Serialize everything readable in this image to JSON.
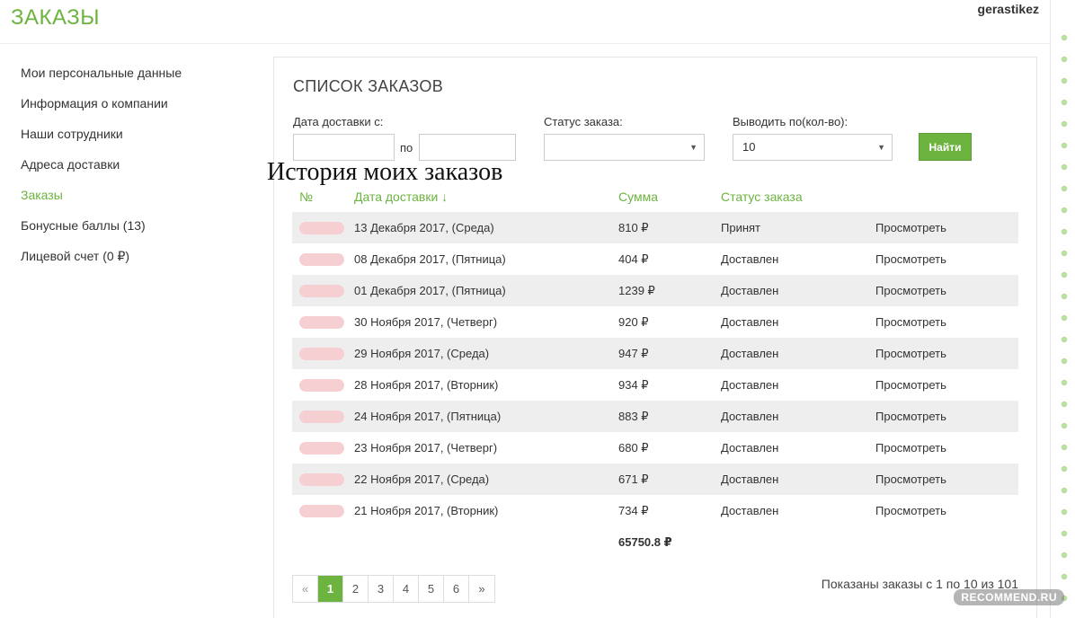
{
  "header": {
    "title": "ЗАКАЗЫ",
    "username": "gerastikez"
  },
  "sidebar": {
    "items": [
      {
        "label": "Мои персональные данные"
      },
      {
        "label": "Информация о компании"
      },
      {
        "label": "Наши сотрудники"
      },
      {
        "label": "Адреса доставки"
      },
      {
        "label": "Заказы"
      },
      {
        "label": "Бонусные баллы (13)"
      },
      {
        "label": "Лицевой счет (0 ₽)"
      }
    ],
    "active_index": 4
  },
  "panel": {
    "title": "СПИСОК ЗАКАЗОВ",
    "overlay_caption": "История моих заказов"
  },
  "filters": {
    "date_label": "Дата доставки с:",
    "date_from": "",
    "to_label": "по",
    "date_to": "",
    "status_label": "Статус заказа:",
    "status_value": "",
    "per_page_label": "Выводить по(кол-во):",
    "per_page_value": "10",
    "find_label": "Найти"
  },
  "table": {
    "headers": {
      "num": "№",
      "date": "Дата доставки ↓",
      "sum": "Сумма",
      "status": "Статус заказа"
    },
    "rows": [
      {
        "date": "13 Декабря 2017, (Среда)",
        "sum": "810 ₽",
        "status": "Принят",
        "action": "Просмотреть"
      },
      {
        "date": "08 Декабря 2017, (Пятница)",
        "sum": "404 ₽",
        "status": "Доставлен",
        "action": "Просмотреть"
      },
      {
        "date": "01 Декабря 2017, (Пятница)",
        "sum": "1239 ₽",
        "status": "Доставлен",
        "action": "Просмотреть"
      },
      {
        "date": "30 Ноября 2017, (Четверг)",
        "sum": "920 ₽",
        "status": "Доставлен",
        "action": "Просмотреть"
      },
      {
        "date": "29 Ноября 2017, (Среда)",
        "sum": "947 ₽",
        "status": "Доставлен",
        "action": "Просмотреть"
      },
      {
        "date": "28 Ноября 2017, (Вторник)",
        "sum": "934 ₽",
        "status": "Доставлен",
        "action": "Просмотреть"
      },
      {
        "date": "24 Ноября 2017, (Пятница)",
        "sum": "883 ₽",
        "status": "Доставлен",
        "action": "Просмотреть"
      },
      {
        "date": "23 Ноября 2017, (Четверг)",
        "sum": "680 ₽",
        "status": "Доставлен",
        "action": "Просмотреть"
      },
      {
        "date": "22 Ноября 2017, (Среда)",
        "sum": "671 ₽",
        "status": "Доставлен",
        "action": "Просмотреть"
      },
      {
        "date": "21 Ноября 2017, (Вторник)",
        "sum": "734 ₽",
        "status": "Доставлен",
        "action": "Просмотреть"
      }
    ],
    "total": "65750.8 ₽"
  },
  "pagination": {
    "prev": "«",
    "pages": [
      "1",
      "2",
      "3",
      "4",
      "5",
      "6"
    ],
    "next": "»",
    "active": "1",
    "summary": "Показаны заказы с 1 по 10 из 101"
  },
  "watermark": "RECOMMEND.RU",
  "colors": {
    "accent": "#6cb33f",
    "row_stripe": "#eeeeee"
  }
}
